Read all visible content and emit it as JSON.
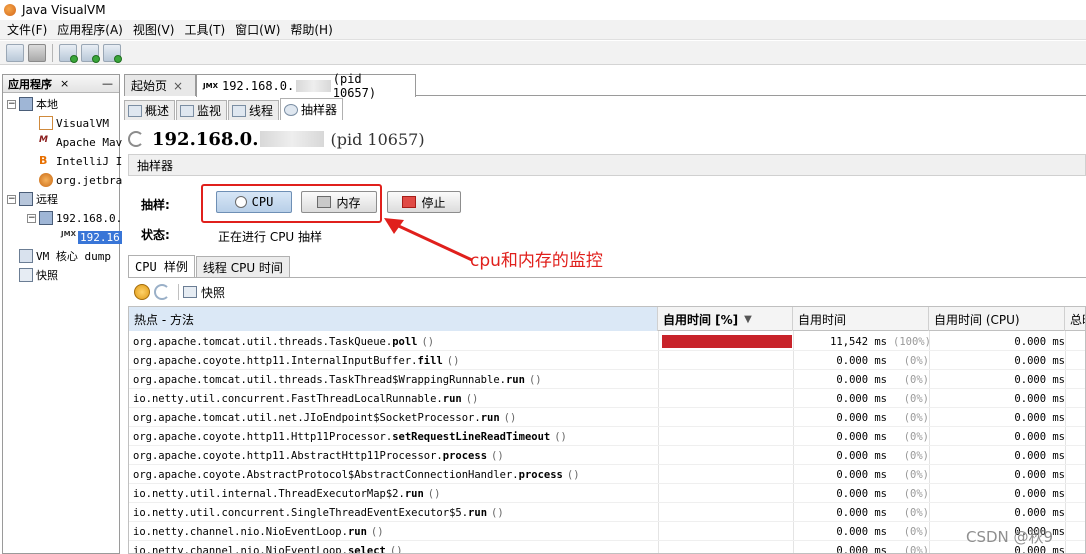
{
  "window": {
    "title": "Java VisualVM"
  },
  "menu": [
    "文件(F)",
    "应用程序(A)",
    "视图(V)",
    "工具(T)",
    "窗口(W)",
    "帮助(H)"
  ],
  "left_panel": {
    "title": "应用程序",
    "close": "×",
    "minimize": "—",
    "tree": [
      {
        "label": "本地",
        "level": 0
      },
      {
        "label": "VisualVM",
        "level": 1
      },
      {
        "label": "Apache Mav",
        "level": 1
      },
      {
        "label": "IntelliJ I",
        "level": 1
      },
      {
        "label": "org.jetbra",
        "level": 1
      },
      {
        "label": "远程",
        "level": 0
      },
      {
        "label": "192.168.0.",
        "level": 1
      },
      {
        "label": "192.16",
        "level": 2
      },
      {
        "label": "VM 核心 dump",
        "level": 0
      },
      {
        "label": "快照",
        "level": 0
      }
    ]
  },
  "doc_tabs": {
    "start": "起始页",
    "process_prefix": "192.168.0.",
    "process_suffix": "(pid 10657)",
    "close": "×"
  },
  "sub_tabs": [
    "概述",
    "监视",
    "线程",
    "抽样器"
  ],
  "header": {
    "ip": "192.168.0.",
    "pid": "(pid 10657)"
  },
  "sampler": {
    "section_title": "抽样器",
    "sample_label": "抽样:",
    "status_label": "状态:",
    "status_value": "正在进行 CPU 抽样",
    "cpu_button": "CPU",
    "memory_button": "内存",
    "stop_button": "停止"
  },
  "annotation": {
    "text": "cpu和内存的监控",
    "color": "#e0201c"
  },
  "result_tabs": [
    "CPU 样例",
    "线程 CPU 时间"
  ],
  "snapshot_button": "快照",
  "table": {
    "headers": [
      "热点 - 方法",
      "自用时间 [%]",
      "自用时间",
      "自用时间 (CPU)",
      "总时"
    ],
    "sort_indicator": "▼",
    "rows": [
      {
        "prefix": "org.apache.tomcat.util.threads.TaskQueue.",
        "method": "poll",
        "share": 1.0,
        "time": "11,542 ms",
        "pct": "(100%)",
        "cpu": "0.000 ms"
      },
      {
        "prefix": "org.apache.coyote.http11.InternalInputBuffer.",
        "method": "fill",
        "share": 0,
        "time": "0.000 ms",
        "pct": "(0%)",
        "cpu": "0.000 ms"
      },
      {
        "prefix": "org.apache.tomcat.util.threads.TaskThread$WrappingRunnable.",
        "method": "run",
        "share": 0,
        "time": "0.000 ms",
        "pct": "(0%)",
        "cpu": "0.000 ms"
      },
      {
        "prefix": "io.netty.util.concurrent.FastThreadLocalRunnable.",
        "method": "run",
        "share": 0,
        "time": "0.000 ms",
        "pct": "(0%)",
        "cpu": "0.000 ms"
      },
      {
        "prefix": "org.apache.tomcat.util.net.JIoEndpoint$SocketProcessor.",
        "method": "run",
        "share": 0,
        "time": "0.000 ms",
        "pct": "(0%)",
        "cpu": "0.000 ms"
      },
      {
        "prefix": "org.apache.coyote.http11.Http11Processor.",
        "method": "setRequestLineReadTimeout",
        "share": 0,
        "time": "0.000 ms",
        "pct": "(0%)",
        "cpu": "0.000 ms"
      },
      {
        "prefix": "org.apache.coyote.http11.AbstractHttp11Processor.",
        "method": "process",
        "share": 0,
        "time": "0.000 ms",
        "pct": "(0%)",
        "cpu": "0.000 ms"
      },
      {
        "prefix": "org.apache.coyote.AbstractProtocol$AbstractConnectionHandler.",
        "method": "process",
        "share": 0,
        "time": "0.000 ms",
        "pct": "(0%)",
        "cpu": "0.000 ms"
      },
      {
        "prefix": "io.netty.util.internal.ThreadExecutorMap$2.",
        "method": "run",
        "share": 0,
        "time": "0.000 ms",
        "pct": "(0%)",
        "cpu": "0.000 ms"
      },
      {
        "prefix": "io.netty.util.concurrent.SingleThreadEventExecutor$5.",
        "method": "run",
        "share": 0,
        "time": "0.000 ms",
        "pct": "(0%)",
        "cpu": "0.000 ms"
      },
      {
        "prefix": "io.netty.channel.nio.NioEventLoop.",
        "method": "run",
        "share": 0,
        "time": "0.000 ms",
        "pct": "(0%)",
        "cpu": "0.000 ms"
      },
      {
        "prefix": "io.netty.channel.nio.NioEventLoop.",
        "method": "select",
        "share": 0,
        "time": "0.000 ms",
        "pct": "(0%)",
        "cpu": "0.000 ms"
      }
    ]
  },
  "watermark": "CSDN @秋9"
}
